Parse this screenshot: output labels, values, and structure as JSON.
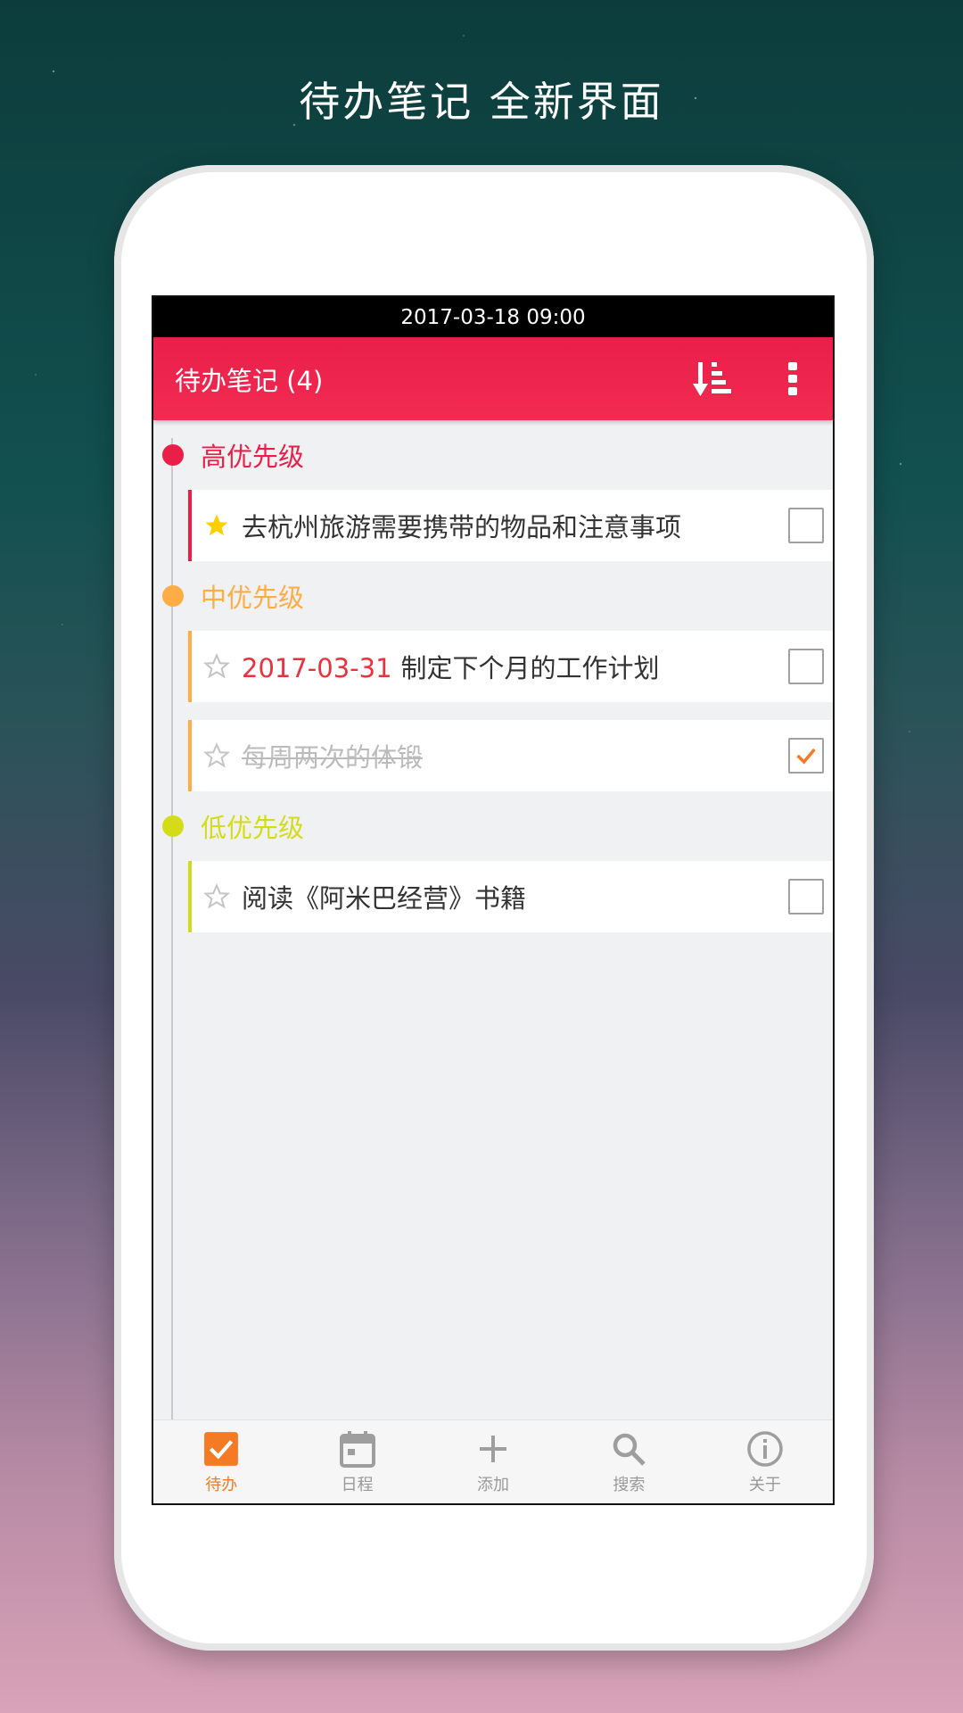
{
  "headline": "待办笔记 全新界面",
  "status_bar": {
    "time": "2017-03-18 09:00"
  },
  "app_bar": {
    "title": "待办笔记 (4)",
    "sort_icon": "sort-icon",
    "menu_icon": "more-vert-icon"
  },
  "colors": {
    "accent": "#f22b52",
    "high": "#e91f49",
    "medium": "#ffac45",
    "low": "#d4dc18",
    "active_tab": "#f47a24"
  },
  "sections": [
    {
      "title": "高优先级",
      "items": [
        {
          "date": "",
          "text": "去杭州旅游需要携带的物品和注意事项",
          "starred": true,
          "checked": false
        }
      ]
    },
    {
      "title": "中优先级",
      "items": [
        {
          "date": "2017-03-31",
          "text": "制定下个月的工作计划",
          "starred": false,
          "checked": false
        },
        {
          "date": "",
          "text": "每周两次的体锻",
          "starred": false,
          "checked": true
        }
      ]
    },
    {
      "title": "低优先级",
      "items": [
        {
          "date": "",
          "text": "阅读《阿米巴经营》书籍",
          "starred": false,
          "checked": false
        }
      ]
    }
  ],
  "bottom_nav": [
    {
      "label": "待办",
      "icon": "todo-check-icon",
      "active": true
    },
    {
      "label": "日程",
      "icon": "calendar-icon",
      "active": false
    },
    {
      "label": "添加",
      "icon": "plus-icon",
      "active": false
    },
    {
      "label": "搜索",
      "icon": "search-icon",
      "active": false
    },
    {
      "label": "关于",
      "icon": "info-icon",
      "active": false
    }
  ]
}
